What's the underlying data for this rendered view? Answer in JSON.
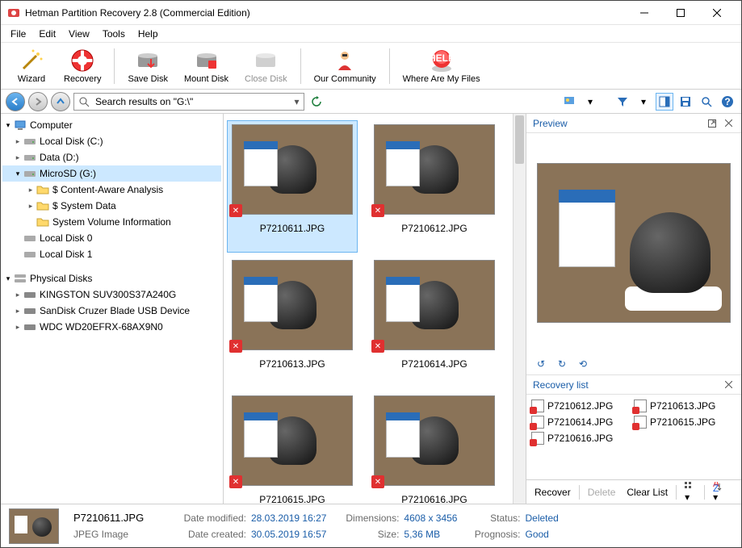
{
  "title": "Hetman Partition Recovery 2.8 (Commercial Edition)",
  "menu": {
    "file": "File",
    "edit": "Edit",
    "view": "View",
    "tools": "Tools",
    "help": "Help"
  },
  "toolbar": {
    "wizard": "Wizard",
    "recovery": "Recovery",
    "saveDisk": "Save Disk",
    "mountDisk": "Mount Disk",
    "closeDisk": "Close Disk",
    "community": "Our Community",
    "whereFiles": "Where Are My Files"
  },
  "address": "Search results on \"G:\\\"",
  "tree": {
    "computer": "Computer",
    "localC": "Local Disk (C:)",
    "dataD": "Data (D:)",
    "microSD": "MicroSD (G:)",
    "caa": "$ Content-Aware Analysis",
    "sysData": "$ System Data",
    "svi": "System Volume Information",
    "localDisk0": "Local Disk 0",
    "localDisk1": "Local Disk 1",
    "physical": "Physical Disks",
    "kingston": "KINGSTON SUV300S37A240G",
    "sandisk": "SanDisk Cruzer Blade USB Device",
    "wdc": "WDC WD20EFRX-68AX9N0"
  },
  "files": [
    {
      "name": "P7210611.JPG",
      "sel": true
    },
    {
      "name": "P7210612.JPG",
      "sel": false
    },
    {
      "name": "P7210613.JPG",
      "sel": false
    },
    {
      "name": "P7210614.JPG",
      "sel": false
    },
    {
      "name": "P7210615.JPG",
      "sel": false
    },
    {
      "name": "P7210616.JPG",
      "sel": false
    }
  ],
  "preview": {
    "title": "Preview"
  },
  "recovery": {
    "title": "Recovery list",
    "items": [
      "P7210612.JPG",
      "P7210613.JPG",
      "P7210614.JPG",
      "P7210615.JPG",
      "P7210616.JPG"
    ],
    "recover": "Recover",
    "delete": "Delete",
    "clear": "Clear List"
  },
  "status": {
    "filename": "P7210611.JPG",
    "filetype": "JPEG Image",
    "modLabel": "Date modified:",
    "modVal": "28.03.2019 16:27",
    "createLabel": "Date created:",
    "createVal": "30.05.2019 16:57",
    "dimLabel": "Dimensions:",
    "dimVal": "4608 x 3456",
    "sizeLabel": "Size:",
    "sizeVal": "5,36 MB",
    "statusLabel": "Status:",
    "statusVal": "Deleted",
    "progLabel": "Prognosis:",
    "progVal": "Good"
  }
}
